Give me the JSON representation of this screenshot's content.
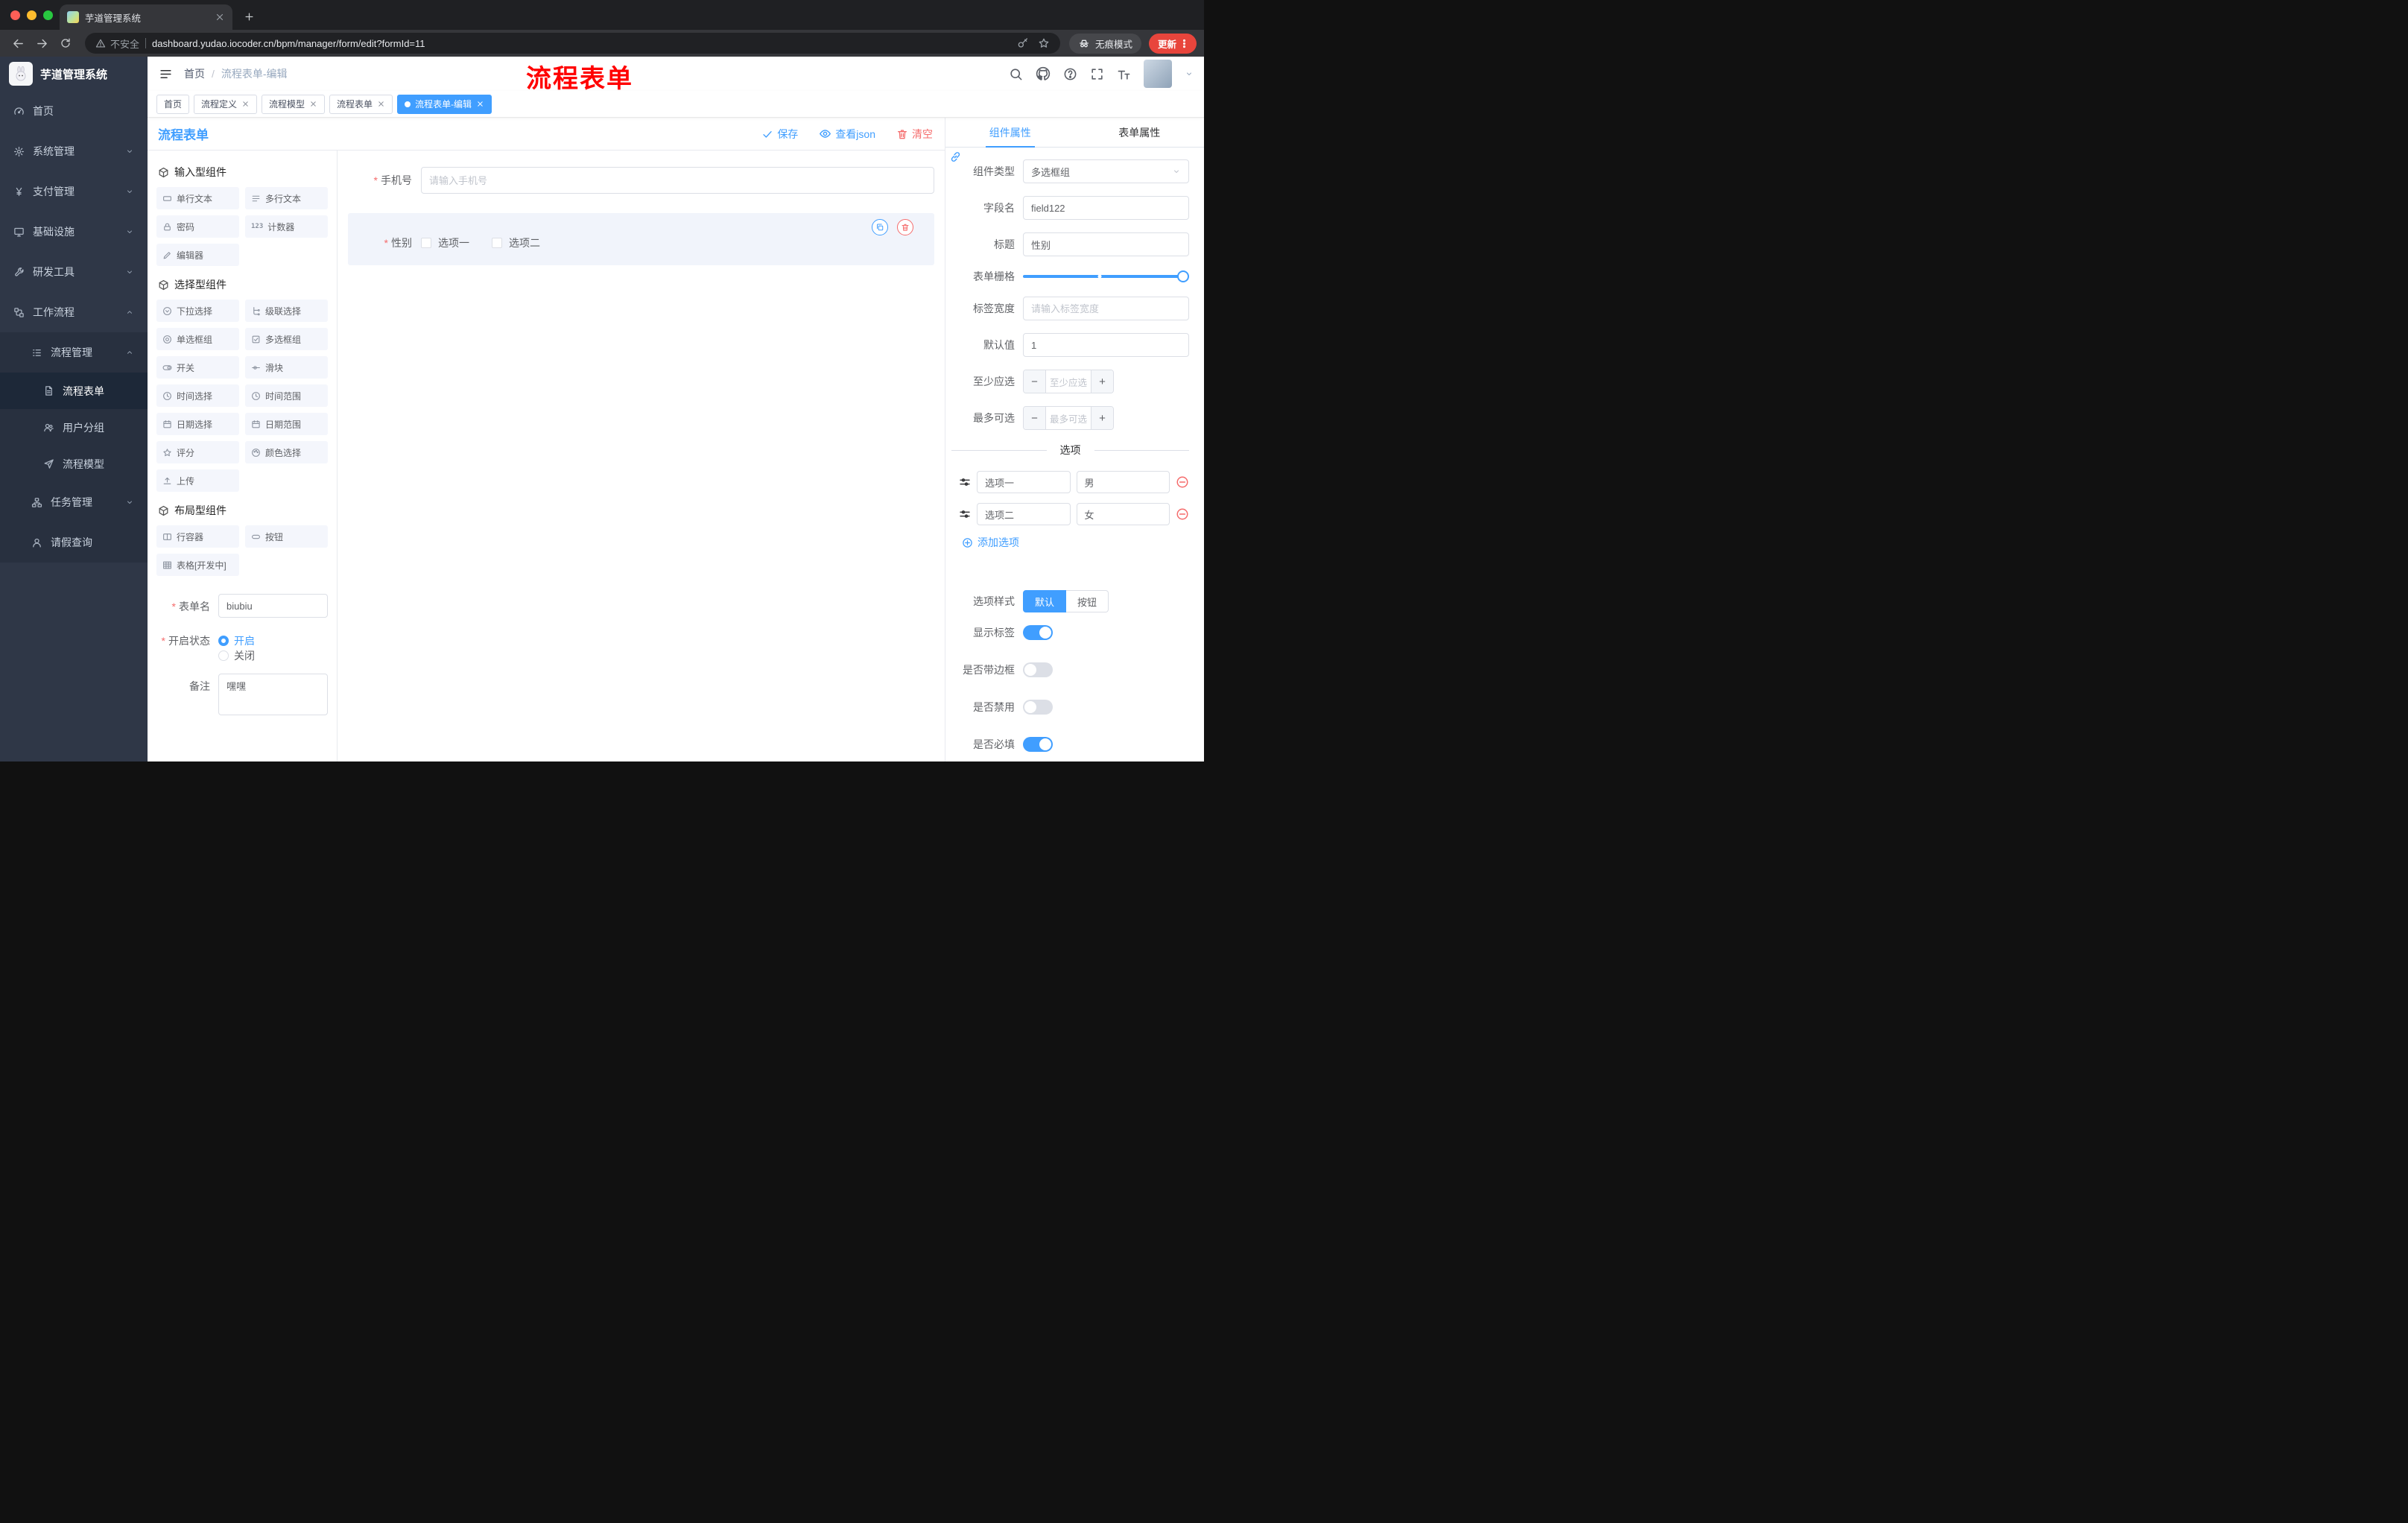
{
  "colors": {
    "accent": "#409eff",
    "danger": "#f56c6c",
    "annotation": "#ff0000",
    "sidebar_bg": "#2f3747",
    "browser_dark": "#202124"
  },
  "browser": {
    "tab_title": "芋道管理系统",
    "security_label": "不安全",
    "url": "dashboard.yudao.iocoder.cn/bpm/manager/form/edit?formId=11",
    "incognito_label": "无痕模式",
    "update_label": "更新"
  },
  "annotation": {
    "text": "流程表单"
  },
  "sidebar": {
    "logo_title": "芋道管理系统",
    "items": [
      {
        "label": "首页"
      },
      {
        "label": "系统管理"
      },
      {
        "label": "支付管理"
      },
      {
        "label": "基础设施"
      },
      {
        "label": "研发工具"
      },
      {
        "label": "工作流程"
      }
    ],
    "workflow": {
      "process_mgmt": "流程管理",
      "children": [
        {
          "label": "流程表单"
        },
        {
          "label": "用户分组"
        },
        {
          "label": "流程模型"
        }
      ],
      "task_mgmt": "任务管理",
      "leave_query": "请假查询"
    }
  },
  "header": {
    "breadcrumb_home": "首页",
    "breadcrumb_current": "流程表单-编辑"
  },
  "tags": [
    {
      "label": "首页"
    },
    {
      "label": "流程定义"
    },
    {
      "label": "流程模型"
    },
    {
      "label": "流程表单"
    },
    {
      "label": "流程表单-编辑"
    }
  ],
  "designer": {
    "title": "流程表单",
    "save": "保存",
    "view_json": "查看json",
    "clear": "清空",
    "palette": {
      "groups": [
        {
          "title": "输入型组件",
          "items": [
            {
              "label": "单行文本"
            },
            {
              "label": "多行文本"
            },
            {
              "label": "密码"
            },
            {
              "label": "计数器"
            },
            {
              "label": "编辑器"
            }
          ]
        },
        {
          "title": "选择型组件",
          "items": [
            {
              "label": "下拉选择"
            },
            {
              "label": "级联选择"
            },
            {
              "label": "单选框组"
            },
            {
              "label": "多选框组"
            },
            {
              "label": "开关"
            },
            {
              "label": "滑块"
            },
            {
              "label": "时间选择"
            },
            {
              "label": "时间范围"
            },
            {
              "label": "日期选择"
            },
            {
              "label": "日期范围"
            },
            {
              "label": "评分"
            },
            {
              "label": "颜色选择"
            },
            {
              "label": "上传"
            }
          ]
        },
        {
          "title": "布局型组件",
          "items": [
            {
              "label": "行容器"
            },
            {
              "label": "按钮"
            },
            {
              "label": "表格[开发中]"
            }
          ]
        }
      ]
    },
    "form_meta": {
      "name_label": "表单名",
      "name_value": "biubiu",
      "status_label": "开启状态",
      "status_on": "开启",
      "status_off": "关闭",
      "remark_label": "备注",
      "remark_value": "嘿嘿"
    },
    "canvas": {
      "phone_label": "手机号",
      "phone_placeholder": "请输入手机号",
      "gender_label": "性别",
      "gender_options": [
        {
          "label": "选项一"
        },
        {
          "label": "选项二"
        }
      ]
    },
    "props": {
      "tab_component": "组件属性",
      "tab_form": "表单属性",
      "component_type_label": "组件类型",
      "component_type_value": "多选框组",
      "field_name_label": "字段名",
      "field_name_value": "field122",
      "title_label": "标题",
      "title_value": "性别",
      "grid_label": "表单栅格",
      "label_width_label": "标签宽度",
      "label_width_placeholder": "请输入标签宽度",
      "default_label": "默认值",
      "default_value": "1",
      "min_select_label": "至少应选",
      "min_select_placeholder": "至少应选",
      "max_select_label": "最多可选",
      "max_select_placeholder": "最多可选",
      "options_title": "选项",
      "options": [
        {
          "label": "选项一",
          "value": "男"
        },
        {
          "label": "选项二",
          "value": "女"
        }
      ],
      "add_option": "添加选项",
      "style_label": "选项样式",
      "style_default": "默认",
      "style_button": "按钮",
      "show_label": "显示标签",
      "border_label": "是否带边框",
      "disabled_label": "是否禁用",
      "required_label": "是否必填"
    }
  }
}
